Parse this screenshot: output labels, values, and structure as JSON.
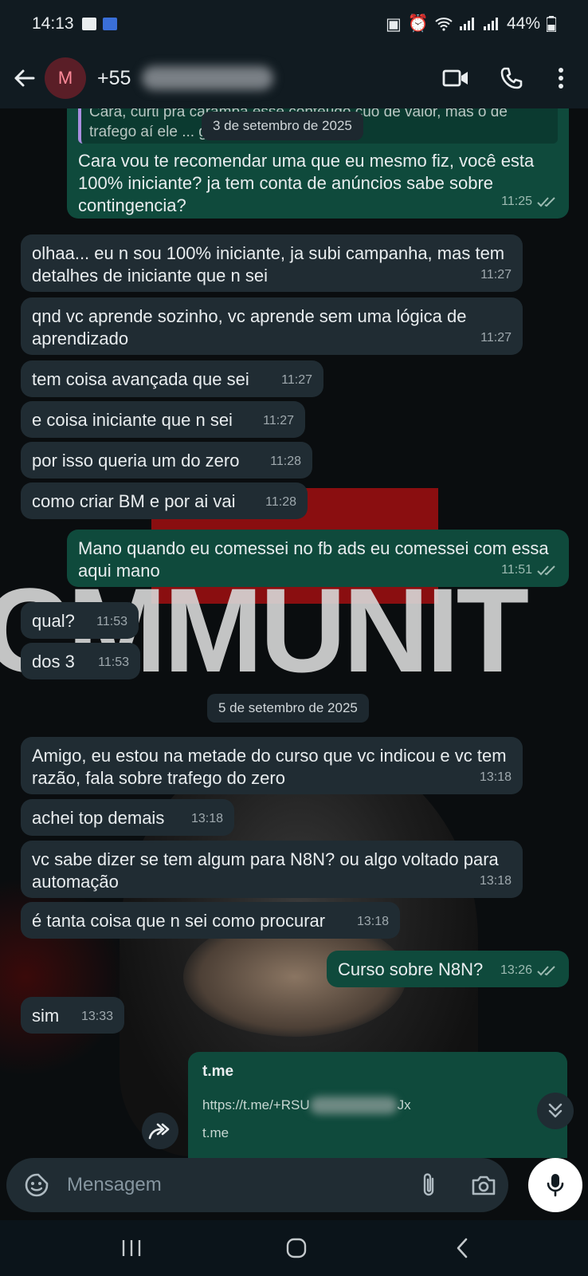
{
  "status_bar": {
    "time": "14:13",
    "battery": "44%"
  },
  "header": {
    "avatar_letter": "M",
    "contact_prefix": "+55"
  },
  "chat": {
    "quoted_text": "Cara, curti pra caramba esse conteúdo cuo de valor, mas o de trafego aí ele ... gum do zero mesmo?",
    "date_1": "3 de setembro de 2025",
    "date_2": "5 de setembro de 2025",
    "messages": [
      {
        "dir": "out",
        "text": "Cara vou te recomendar uma que eu mesmo fiz, você esta 100% iniciante? ja tem conta de anúncios sabe sobre contingencia?",
        "time": "11:25"
      },
      {
        "dir": "in",
        "text": "olhaa... eu n sou 100% iniciante, ja subi campanha, mas tem detalhes de iniciante que n sei",
        "time": "11:27"
      },
      {
        "dir": "in",
        "text": "qnd vc aprende sozinho, vc aprende sem uma lógica de aprendizado",
        "time": "11:27"
      },
      {
        "dir": "in",
        "text": "tem coisa avançada que sei",
        "time": "11:27"
      },
      {
        "dir": "in",
        "text": "e coisa iniciante que n sei",
        "time": "11:27"
      },
      {
        "dir": "in",
        "text": "por isso queria um do zero",
        "time": "11:28"
      },
      {
        "dir": "in",
        "text": "como criar BM e por ai vai",
        "time": "11:28"
      },
      {
        "dir": "out",
        "text": "Mano quando eu comessei no fb ads eu comessei com essa aqui mano",
        "time": "11:51"
      },
      {
        "dir": "in",
        "text": "qual?",
        "time": "11:53"
      },
      {
        "dir": "in",
        "text": "dos 3",
        "time": "11:53"
      },
      {
        "dir": "in",
        "text": "Amigo, eu estou na metade do curso que vc indicou e vc tem razão, fala sobre trafego do zero",
        "time": "13:18"
      },
      {
        "dir": "in",
        "text": "achei top demais",
        "time": "13:18"
      },
      {
        "dir": "in",
        "text": "vc sabe dizer se tem algum para N8N? ou algo voltado para automação",
        "time": "13:18"
      },
      {
        "dir": "in",
        "text": "é tanta coisa que n sei como procurar",
        "time": "13:18"
      },
      {
        "dir": "out",
        "text": "Curso sobre N8N?",
        "time": "13:26"
      },
      {
        "dir": "in",
        "text": "sim",
        "time": "13:33"
      }
    ],
    "link_preview": {
      "title": "t.me",
      "url_start": "https://t.me/+RSU",
      "url_end": "Jx",
      "domain": "t.me"
    }
  },
  "composer": {
    "placeholder": "Mensagem"
  },
  "colors": {
    "incoming": "#202c33",
    "outgoing": "#0f4a3c",
    "header": "#111b21"
  }
}
